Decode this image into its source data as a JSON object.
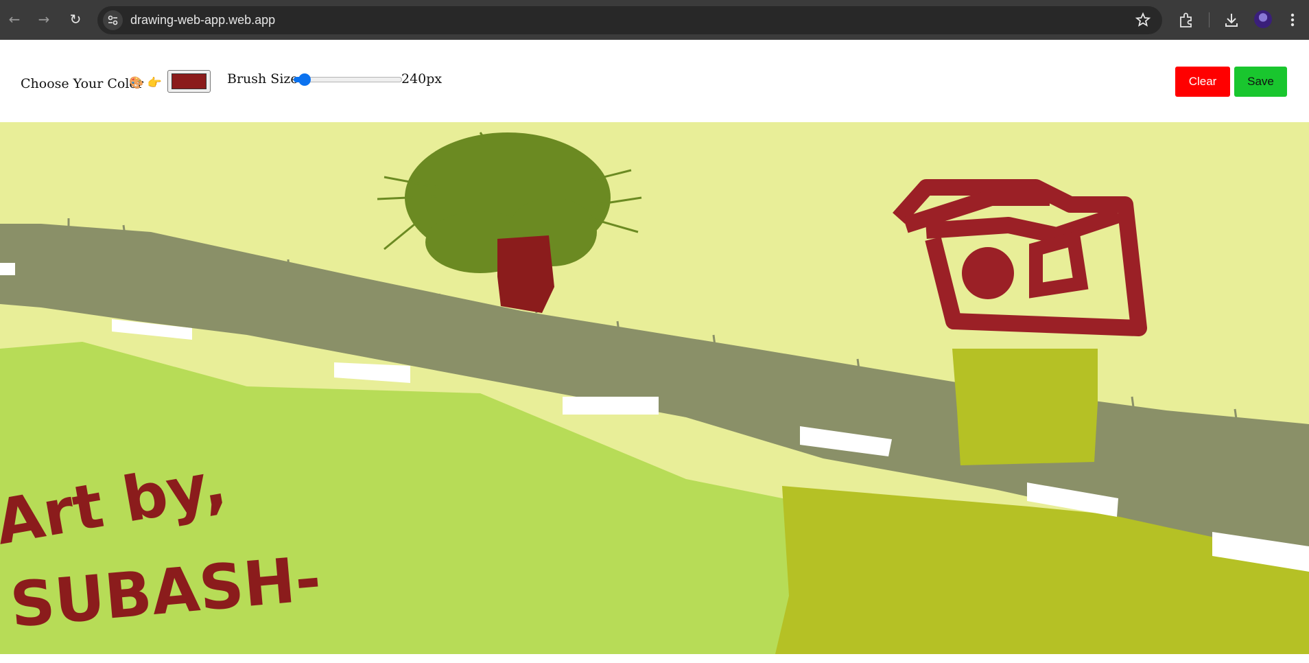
{
  "browser": {
    "url": "drawing-web-app.web.app",
    "icons": [
      "back-icon",
      "forward-icon",
      "reload-icon",
      "site-info-icon",
      "bookmark-star-icon",
      "extensions-icon",
      "download-icon",
      "profile-avatar",
      "more-menu-icon"
    ]
  },
  "toolbar": {
    "color_label": "Choose Your Color",
    "color_emoji": "🎨 👉",
    "color_value": "#8b1c1c",
    "brush_label": "Brush Size",
    "brush_value_text": "240px",
    "brush_level": 0.05,
    "clear_label": "Clear",
    "save_label": "Save"
  },
  "canvas": {
    "signature_line1": "Art by,",
    "signature_line2": "SUBASH-",
    "colors": {
      "sky": "#e8ee98",
      "road": "#8a9068",
      "grass": "#b7dc57",
      "field": "#b5c125",
      "tree_top": "#6b8a22",
      "brown": "#8b1c1c",
      "house": "#9b2026",
      "marks": "#ffffff"
    }
  }
}
